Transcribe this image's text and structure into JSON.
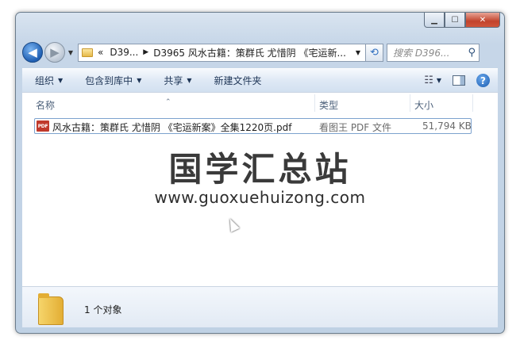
{
  "window": {
    "controls": {
      "minimize": "▁",
      "maximize": "☐",
      "close": "✕"
    }
  },
  "nav": {
    "back_glyph": "◀",
    "forward_glyph": "▶",
    "dropdown_glyph": "▼",
    "address": {
      "prefix": "«",
      "crumbs": [
        "D39...",
        "D3965 风水古籍：策群氏 尤惜阴 《宅运新..."
      ],
      "dropdown_glyph": "▼"
    },
    "refresh_glyph": "⟲",
    "search_placeholder": "搜索 D396...",
    "search_icon_glyph": "⚲"
  },
  "toolbar": {
    "items": [
      "组织",
      "包含到库中",
      "共享",
      "新建文件夹"
    ],
    "dropdown_glyph": "▼",
    "view_glyph": "☷",
    "help_glyph": "?"
  },
  "columns": {
    "name": "名称",
    "type": "类型",
    "size": "大小",
    "sort_glyph": "⌃"
  },
  "files": [
    {
      "icon_text": "PDF",
      "name": "风水古籍：策群氏 尤惜阴 《宅运新案》全集1220页.pdf",
      "type": "看图王 PDF 文件",
      "size": "51,794 KB"
    }
  ],
  "watermark": {
    "title": "国学汇总站",
    "url": "www.guoxuehuizong.com"
  },
  "details": {
    "count": "1 个对象"
  },
  "colors": {
    "accent": "#1f5fb3",
    "close_red": "#c2432c",
    "pdf_red": "#c0392b"
  }
}
